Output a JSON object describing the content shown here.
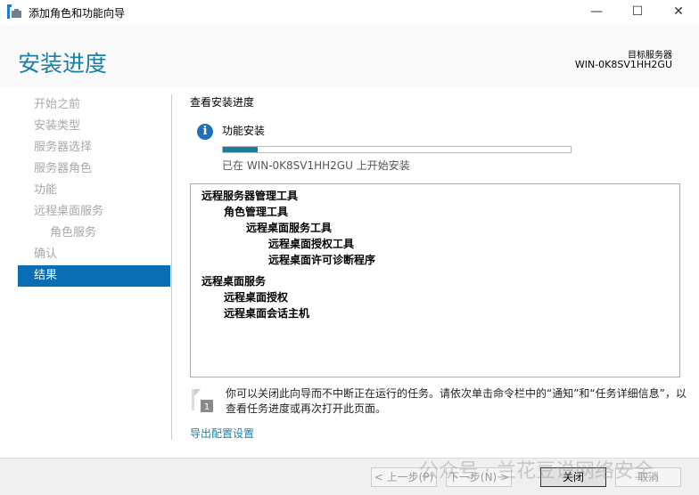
{
  "window": {
    "title": "添加角色和功能向导"
  },
  "header": {
    "title": "安装进度",
    "server_label": "目标服务器",
    "server_name": "WIN-0K8SV1HH2GU"
  },
  "nav": {
    "items": [
      {
        "label": "开始之前"
      },
      {
        "label": "安装类型"
      },
      {
        "label": "服务器选择"
      },
      {
        "label": "服务器角色"
      },
      {
        "label": "功能"
      },
      {
        "label": "远程桌面服务"
      },
      {
        "label": "角色服务"
      },
      {
        "label": "确认"
      },
      {
        "label": "结果"
      }
    ]
  },
  "main": {
    "section_title": "查看安装进度",
    "feature_label": "功能安装",
    "progress": 0.1,
    "status": "已在 WIN-0K8SV1HH2GU 上开始安装",
    "list": [
      {
        "text": "远程服务器管理工具",
        "level": 0
      },
      {
        "text": "角色管理工具",
        "level": 1
      },
      {
        "text": "远程桌面服务工具",
        "level": 2
      },
      {
        "text": "远程桌面授权工具",
        "level": 3
      },
      {
        "text": "远程桌面许可诊断程序",
        "level": 3
      },
      {
        "text": "远程桌面服务",
        "level": 0
      },
      {
        "text": "远程桌面授权",
        "level": 1
      },
      {
        "text": "远程桌面会话主机",
        "level": 1
      }
    ],
    "note": "你可以关闭此向导而不中断正在运行的任务。请依次单击命令栏中的“通知”和“任务详细信息”，以查看任务进度或再次打开此页面。",
    "export_link": "导出配置设置"
  },
  "footer": {
    "prev": "< 上一步(P)",
    "next": "下一步(N) >",
    "close": "关闭",
    "cancel": "取消",
    "watermark": "公众号 · 兰花豆说网络安全"
  }
}
